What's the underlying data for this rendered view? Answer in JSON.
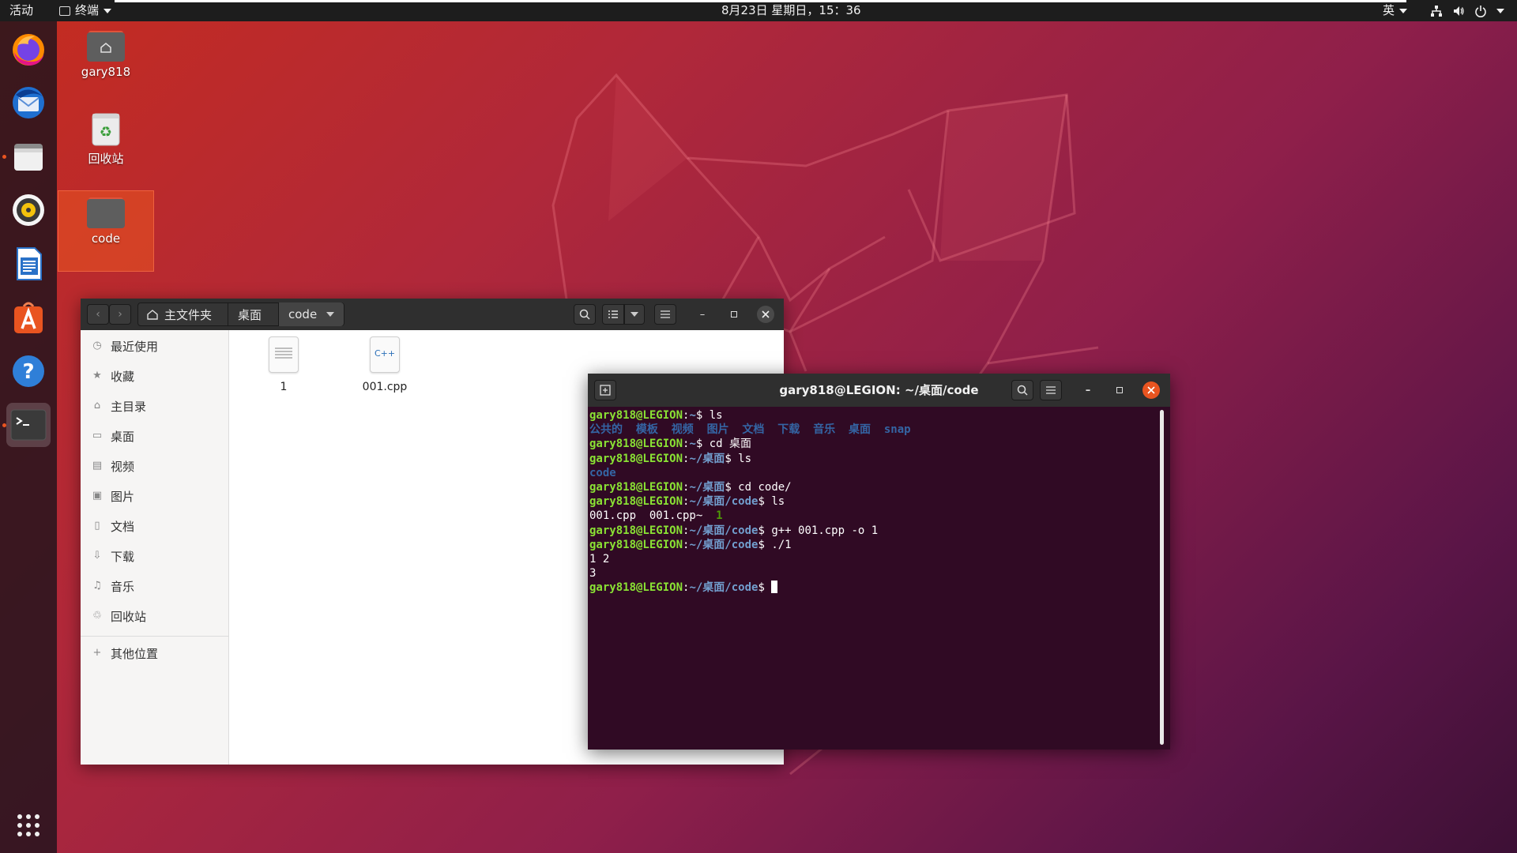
{
  "topbar": {
    "activities": "活动",
    "app_menu": "终端",
    "clock": "8月23日 星期日，15：36",
    "input_method": "英"
  },
  "dock": {
    "items": [
      {
        "name": "firefox-icon"
      },
      {
        "name": "thunderbird-icon"
      },
      {
        "name": "files-icon"
      },
      {
        "name": "rhythmbox-icon"
      },
      {
        "name": "libreoffice-writer-icon"
      },
      {
        "name": "software-center-icon"
      },
      {
        "name": "help-icon"
      },
      {
        "name": "terminal-icon"
      }
    ]
  },
  "desktop": {
    "icons": [
      {
        "label": "gary818"
      },
      {
        "label": "回收站"
      },
      {
        "label": "code"
      }
    ]
  },
  "file_manager": {
    "breadcrumbs": [
      "主文件夹",
      "桌面",
      "code"
    ],
    "sidebar": [
      {
        "label": "最近使用",
        "icon": "clock-icon"
      },
      {
        "label": "收藏",
        "icon": "star-icon"
      },
      {
        "label": "主目录",
        "icon": "home-icon"
      },
      {
        "label": "桌面",
        "icon": "desktop-icon"
      },
      {
        "label": "视频",
        "icon": "video-icon"
      },
      {
        "label": "图片",
        "icon": "image-icon"
      },
      {
        "label": "文档",
        "icon": "document-icon"
      },
      {
        "label": "下载",
        "icon": "download-icon"
      },
      {
        "label": "音乐",
        "icon": "music-icon"
      },
      {
        "label": "回收站",
        "icon": "trash-icon"
      },
      {
        "label": "其他位置",
        "icon": "plus-icon"
      }
    ],
    "files": [
      {
        "name": "1",
        "icon_text": ""
      },
      {
        "name": "001.cpp",
        "icon_text": "C++"
      }
    ]
  },
  "terminal": {
    "title": "gary818@LEGION: ~/桌面/code",
    "lines": [
      [
        {
          "t": "gary818@LEGION",
          "c": "u"
        },
        {
          "t": ":",
          "c": ""
        },
        {
          "t": "~",
          "c": "p"
        },
        {
          "t": "$ ls",
          "c": ""
        }
      ],
      [
        {
          "t": "公共的  模板  视频  图片  文档  下载  音乐  桌面  snap",
          "c": "d"
        }
      ],
      [
        {
          "t": "gary818@LEGION",
          "c": "u"
        },
        {
          "t": ":",
          "c": ""
        },
        {
          "t": "~",
          "c": "p"
        },
        {
          "t": "$ cd 桌面",
          "c": ""
        }
      ],
      [
        {
          "t": "gary818@LEGION",
          "c": "u"
        },
        {
          "t": ":",
          "c": ""
        },
        {
          "t": "~/桌面",
          "c": "p"
        },
        {
          "t": "$ ls",
          "c": ""
        }
      ],
      [
        {
          "t": "code",
          "c": "d"
        }
      ],
      [
        {
          "t": "gary818@LEGION",
          "c": "u"
        },
        {
          "t": ":",
          "c": ""
        },
        {
          "t": "~/桌面",
          "c": "p"
        },
        {
          "t": "$ cd code/",
          "c": ""
        }
      ],
      [
        {
          "t": "gary818@LEGION",
          "c": "u"
        },
        {
          "t": ":",
          "c": ""
        },
        {
          "t": "~/桌面/code",
          "c": "p"
        },
        {
          "t": "$ ls",
          "c": ""
        }
      ],
      [
        {
          "t": "001.cpp  001.cpp~  ",
          "c": ""
        },
        {
          "t": "1",
          "c": "exe"
        }
      ],
      [
        {
          "t": "gary818@LEGION",
          "c": "u"
        },
        {
          "t": ":",
          "c": ""
        },
        {
          "t": "~/桌面/code",
          "c": "p"
        },
        {
          "t": "$ g++ 001.cpp -o 1",
          "c": ""
        }
      ],
      [
        {
          "t": "gary818@LEGION",
          "c": "u"
        },
        {
          "t": ":",
          "c": ""
        },
        {
          "t": "~/桌面/code",
          "c": "p"
        },
        {
          "t": "$ ./1",
          "c": ""
        }
      ],
      [
        {
          "t": "1 2",
          "c": ""
        }
      ],
      [
        {
          "t": "3",
          "c": ""
        }
      ],
      [
        {
          "t": "gary818@LEGION",
          "c": "u"
        },
        {
          "t": ":",
          "c": ""
        },
        {
          "t": "~/桌面/code",
          "c": "p"
        },
        {
          "t": "$ ",
          "c": ""
        }
      ]
    ]
  }
}
